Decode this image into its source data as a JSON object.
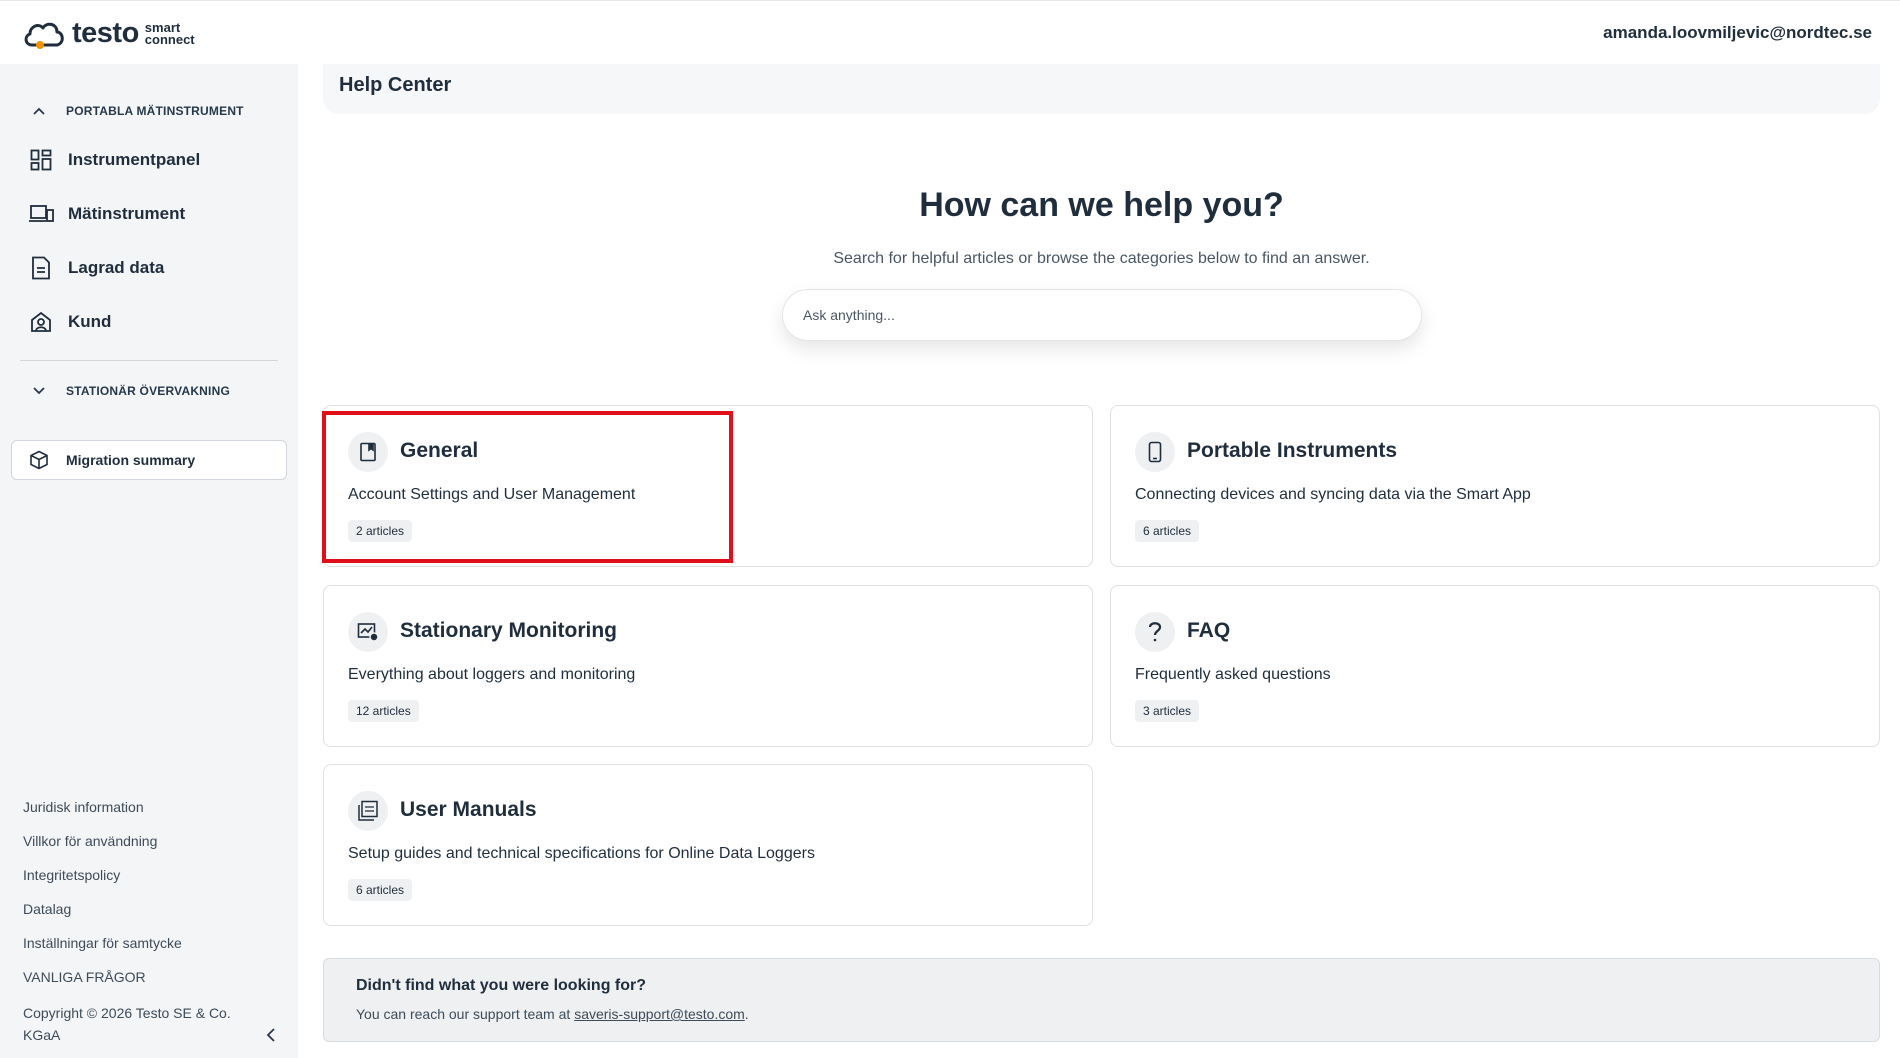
{
  "header": {
    "logo_word": "testo",
    "logo_sub_top": "smart",
    "logo_sub_bottom": "connect",
    "user_email": "amanda.loovmiljevic@nordtec.se"
  },
  "sidebar": {
    "section_portable": "PORTABLA MÄTINSTRUMENT",
    "items": [
      {
        "label": "Instrumentpanel",
        "icon": "dashboard-grid-icon"
      },
      {
        "label": "Mätinstrument",
        "icon": "devices-icon"
      },
      {
        "label": "Lagrad data",
        "icon": "document-icon"
      },
      {
        "label": "Kund",
        "icon": "customer-icon"
      }
    ],
    "section_stationary": "STATIONÄR ÖVERVAKNING",
    "migration_label": "Migration summary",
    "footer_links": [
      "Juridisk information",
      "Villkor för användning",
      "Integritetspolicy",
      "Datalag",
      "Inställningar för samtycke",
      "VANLIGA FRÅGOR"
    ],
    "copyright": "Copyright © 2026 Testo SE & Co. KGaA"
  },
  "page": {
    "title": "Help Center"
  },
  "hero": {
    "title": "How can we help you?",
    "subtitle": "Search for helpful articles or browse the categories below to find an answer.",
    "search_placeholder": "Ask anything..."
  },
  "categories": [
    {
      "title": "General",
      "description": "Account Settings and User Management",
      "count": "2 articles",
      "icon": "book-icon"
    },
    {
      "title": "Portable Instruments",
      "description": "Connecting devices and syncing data via the Smart App",
      "count": "6 articles",
      "icon": "phone-icon"
    },
    {
      "title": "Stationary Monitoring",
      "description": "Everything about loggers and monitoring",
      "count": "12 articles",
      "icon": "monitoring-icon"
    },
    {
      "title": "FAQ",
      "description": "Frequently asked questions",
      "count": "3 articles",
      "icon": "question-icon"
    },
    {
      "title": "User Manuals",
      "description": "Setup guides and technical specifications for Online Data Loggers",
      "count": "6 articles",
      "icon": "pdf-icon"
    }
  ],
  "support": {
    "title": "Didn't find what you were looking for?",
    "text_before": "You can reach our support team at ",
    "email": "saveris-support@testo.com",
    "text_after": "."
  },
  "colors": {
    "highlight": "#e0101b",
    "accent_orange": "#f39200",
    "text_dark": "#1f2d3d"
  }
}
